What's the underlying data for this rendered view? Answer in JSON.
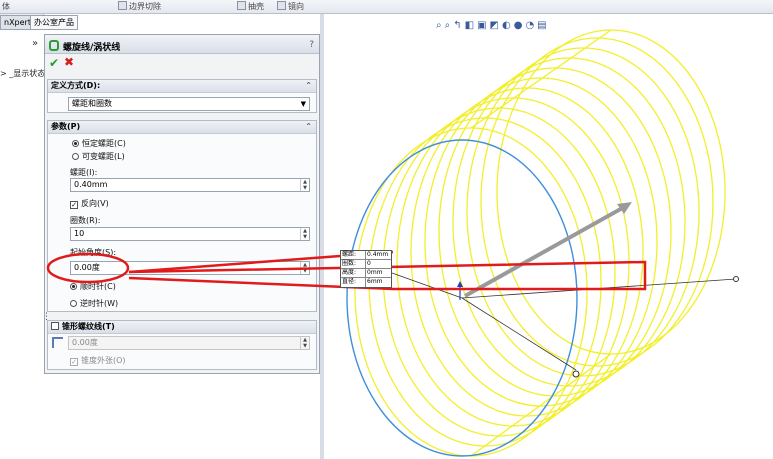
{
  "toolbar": {
    "items": [
      "体",
      "边界切除",
      "抽壳",
      "镜向"
    ]
  },
  "left_tabs": [
    "nXpert",
    "办公室产品"
  ],
  "tree": {
    "expand_arrow": "»",
    "item_text": "> _显示状态"
  },
  "property_manager": {
    "title": "螺旋线/涡状线",
    "help": "?",
    "ok_symbol": "✔",
    "cancel_symbol": "✖"
  },
  "definition": {
    "header": "定义方式(D):",
    "selected": "螺距和圈数"
  },
  "parameters": {
    "header": "参数(P)",
    "constant_pitch": "恒定螺距(C)",
    "variable_pitch": "可变螺距(L)",
    "pitch_label": "螺距(I):",
    "pitch_value": "0.40mm",
    "reverse_label": "反向(V)",
    "revolutions_label": "圈数(R):",
    "revolutions_value": "10",
    "start_angle_label": "起始角度(S):",
    "start_angle_value": "0.00度",
    "clockwise": "顺时针(C)",
    "counterclockwise": "逆时针(W)"
  },
  "taper": {
    "header": "锥形螺纹线(T)",
    "angle_value": "0.00度",
    "outward_label": "锥度外张(O)"
  },
  "readout": {
    "rows": [
      {
        "label": "螺距:",
        "value": "0.4mm"
      },
      {
        "label": "圈数:",
        "value": "0"
      },
      {
        "label": "高度:",
        "value": "0mm"
      },
      {
        "label": "直径:",
        "value": "6mm"
      }
    ]
  },
  "colors": {
    "helix": "#f2ef2a",
    "circle": "#3f8fd8",
    "annotation": "#e01b1b",
    "ok_green": "#1f9a2c"
  }
}
